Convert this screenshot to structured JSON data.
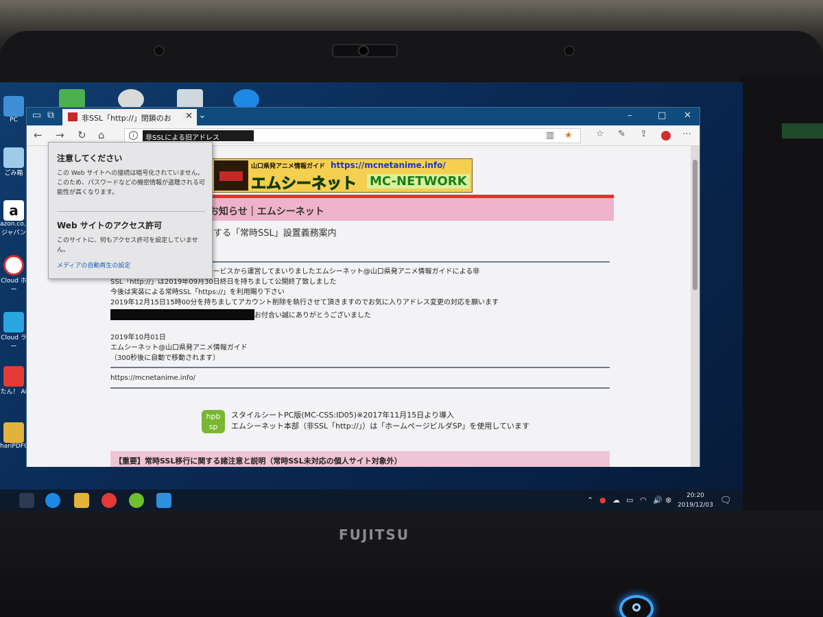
{
  "laptop": {
    "brand": "FUJITSU"
  },
  "desktop": {
    "icons": [
      {
        "label": "PC"
      },
      {
        "label": "ごみ箱"
      },
      {
        "label": "azon.co.j\nジャパン"
      },
      {
        "label": "Cloud ホー"
      },
      {
        "label": "Cloud ラ\nー"
      },
      {
        "label": "たん！ AI"
      },
      {
        "label": "hariPDFC"
      }
    ]
  },
  "browser": {
    "tab_title": "非SSL「http://」閉鎖のお",
    "address": "非SSLによる旧アドレス",
    "nav": {
      "back": "←",
      "forward": "→",
      "refresh": "↻",
      "home": "⌂",
      "new_tab": "+",
      "tab_menu": "⌄"
    },
    "window_controls": {
      "minimize": "–",
      "maximize": "□",
      "close": "✕"
    },
    "toolbar_icons": [
      "reading-view",
      "favorite-star",
      "favorites-hub",
      "pen",
      "share",
      "extension",
      "more"
    ]
  },
  "page": {
    "banner": {
      "small": "山口県発アニメ情報ガイド",
      "url": "https://mcnetanime.info/",
      "big": "エムシーネット",
      "mc": "MC-NETWORK"
    },
    "title": "鎖のお知らせ｜エムシーネット",
    "subtitle": "する「常時SSL」設置義務案内",
    "paragraphs": [
      "さん運営のアットホームページサービスから運営してまいりましたエムシーネット@山口県発アニメ情報ガイドによる非",
      "SSL「http://」は2019年09月30日終日を持ちまして公開終了致しました",
      "今後は実装による常時SSL「https://」を利用賜り下さい",
      "2019年12月15日15時00分を持ちましてアカウント削除を執行させて頂きますのでお気に入りアドレス変更の対応を願います",
      "お付合い誠にありがとうございました"
    ],
    "date": "2019年10月01日",
    "signature": "エムシーネット@山口県発アニメ情報ガイド",
    "redirect": "（300秒後に自動で移動されます）",
    "link": "https://mcnetanime.info/",
    "hpb_logo": "hpb\nsp",
    "stylesheet_line1": "スタイルシートPC版(MC-CSS:ID05)※2017年11月15日より導入",
    "stylesheet_line2": "エムシーネット本部（非SSL「http://」）は「ホームページビルダSP」を使用しています",
    "notice": "【重要】常時SSL移行に関する諸注意と説明（常時SSL未対応の個人サイト対象外）"
  },
  "popup": {
    "heading1": "注意してください",
    "text1": "この Web サイトへの接続は暗号化されていません。このため、パスワードなどの機密情報が盗聴される可能性が高くなります。",
    "heading2": "Web サイトのアクセス許可",
    "text2": "このサイトに、何もアクセス許可を設定していません。",
    "link": "メディアの自動再生の設定"
  },
  "taskbar": {
    "time": "20:20",
    "date": "2019/12/03"
  },
  "colors": {
    "accent": "#0f4b7d",
    "title_pink": "#efb3c9",
    "title_red": "#e8312a",
    "banner_yellow": "#f5cf50"
  }
}
